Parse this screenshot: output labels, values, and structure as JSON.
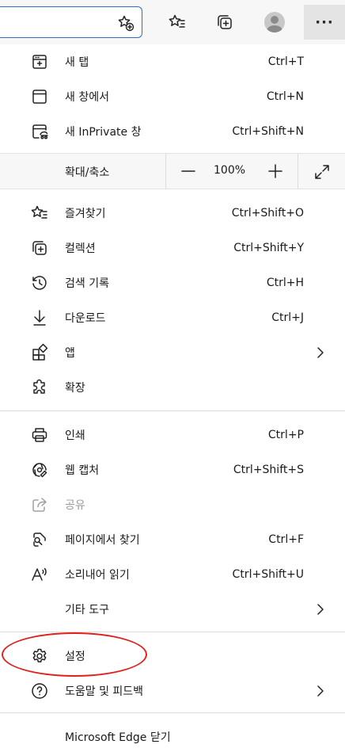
{
  "toolbar": {
    "add_favorite_icon": "star-plus-icon",
    "favorites_icon": "favorites-list-icon",
    "collections_icon": "collections-icon",
    "profile_icon": "profile-avatar-icon",
    "more_label": "···"
  },
  "menu": {
    "new_tab": {
      "label": "새 탭",
      "shortcut": "Ctrl+T"
    },
    "new_window": {
      "label": "새 창에서",
      "shortcut": "Ctrl+N"
    },
    "new_inprivate": {
      "label": "새 InPrivate 창",
      "shortcut": "Ctrl+Shift+N"
    },
    "zoom": {
      "label": "확대/축소",
      "minus": "—",
      "value": "100%",
      "plus": "+"
    },
    "favorites": {
      "label": "즐겨찾기",
      "shortcut": "Ctrl+Shift+O"
    },
    "collections": {
      "label": "컬렉션",
      "shortcut": "Ctrl+Shift+Y"
    },
    "history": {
      "label": "검색 기록",
      "shortcut": "Ctrl+H"
    },
    "downloads": {
      "label": "다운로드",
      "shortcut": "Ctrl+J"
    },
    "apps": {
      "label": "앱"
    },
    "extensions": {
      "label": "확장"
    },
    "print": {
      "label": "인쇄",
      "shortcut": "Ctrl+P"
    },
    "web_capture": {
      "label": "웹 캡처",
      "shortcut": "Ctrl+Shift+S"
    },
    "share": {
      "label": "공유"
    },
    "find": {
      "label": "페이지에서 찾기",
      "shortcut": "Ctrl+F"
    },
    "read_aloud": {
      "label": "소리내어 읽기",
      "shortcut": "Ctrl+Shift+U"
    },
    "more_tools": {
      "label": "기타 도구"
    },
    "settings": {
      "label": "설정"
    },
    "help": {
      "label": "도움말 및 피드백"
    },
    "close_edge": {
      "label": "Microsoft Edge 닫기"
    }
  },
  "colors": {
    "highlight_ellipse": "#e0201c",
    "address_border": "#2c6fbf"
  }
}
